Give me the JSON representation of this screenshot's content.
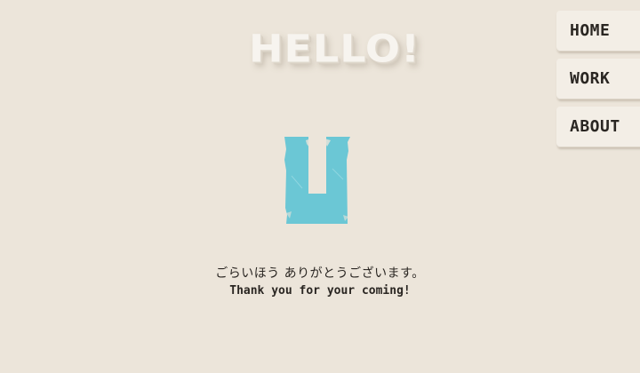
{
  "title": "HELLO!",
  "logo": {
    "icon": "u-letter-logo-icon",
    "color": "#6bc7d5"
  },
  "message": {
    "japanese": "ごらいほう ありがとうございます。",
    "english": "Thank you for your coming!"
  },
  "nav": {
    "home": "HOME",
    "work": "WORK",
    "about": "ABOUT"
  },
  "colors": {
    "background": "#ece5da",
    "accent": "#6bc7d5",
    "text": "#2a2622"
  }
}
